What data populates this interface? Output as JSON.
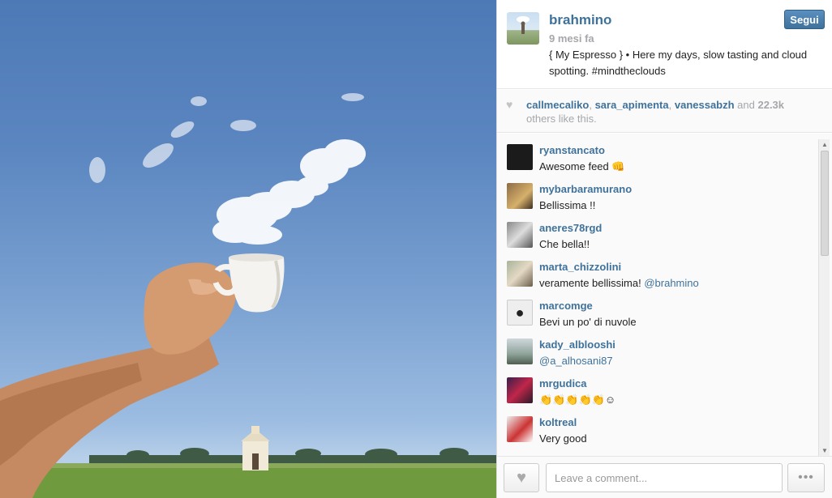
{
  "post": {
    "username": "brahmino",
    "time": "9 mesi fa",
    "follow_label": "Segui",
    "caption_main": "{ My Espresso } • Here my days, slow tasting and cloud spotting. ",
    "caption_tag": "#mindtheclouds"
  },
  "likes": {
    "user1": "callmecaliko",
    "sep1": ", ",
    "user2": "sara_apimenta",
    "sep2": ", ",
    "user3": "vanessabzh",
    "and": " and ",
    "count": "22.3k",
    "others": "others like this."
  },
  "comments": [
    {
      "user": "ryanstancato",
      "text": "Awesome feed 👊",
      "mention": ""
    },
    {
      "user": "mybarbaramurano",
      "text": "Bellissima !!",
      "mention": ""
    },
    {
      "user": "aneres78rgd",
      "text": "Che bella!!",
      "mention": ""
    },
    {
      "user": "marta_chizzolini",
      "text": "veramente bellissima! ",
      "mention": "@brahmino"
    },
    {
      "user": "marcomge",
      "text": "Bevi un po' di nuvole",
      "mention": ""
    },
    {
      "user": "kady_alblooshi",
      "text": "",
      "mention": "@a_alhosani87"
    },
    {
      "user": "mrgudica",
      "text": "👏👏👏👏👏☺",
      "mention": ""
    },
    {
      "user": "koltreal",
      "text": "Very good",
      "mention": ""
    }
  ],
  "footer": {
    "comment_placeholder": "Leave a comment...",
    "more_label": "•••"
  },
  "icons": {
    "like": "heart-icon",
    "more": "ellipsis-icon"
  },
  "colors": {
    "link": "#3f729b",
    "follow_button": "#3f729b"
  }
}
